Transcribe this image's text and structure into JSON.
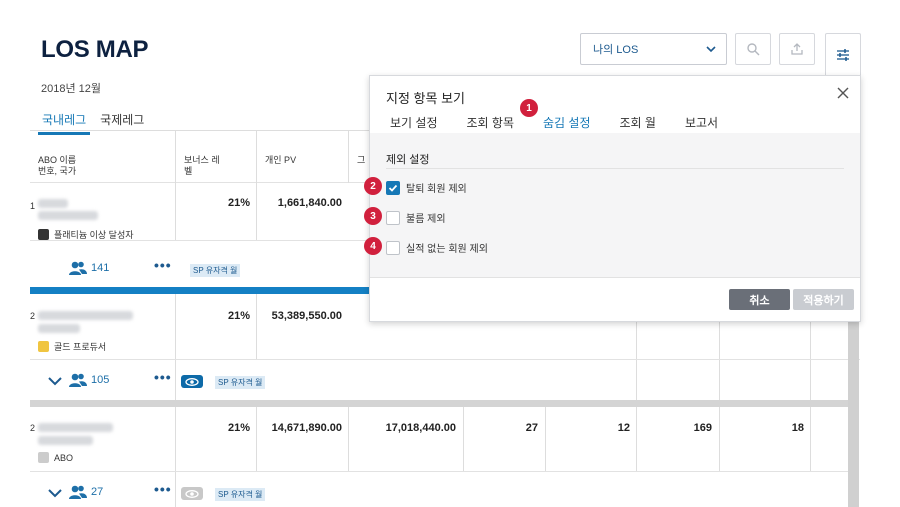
{
  "header": {
    "title": "LOS MAP",
    "period": "2018년 12월"
  },
  "toolbar": {
    "los_select_value": "나의 LOS",
    "icons": [
      "search-icon",
      "export-icon",
      "filter-settings-icon"
    ]
  },
  "main_tabs": [
    {
      "label": "국내레그",
      "active": true
    },
    {
      "label": "국제레그",
      "active": false
    }
  ],
  "table": {
    "headers": {
      "abo": "ABO 이름",
      "abo2": "번호, 국가",
      "bonus": "보너스 레",
      "bonus2": "벨",
      "pv": "개인 PV",
      "group": "그"
    },
    "rows": [
      {
        "index": "1",
        "bonus": "21%",
        "pv": "1,661,840.00",
        "legend": "플래티늄 이상 달성자",
        "legend_color": "#333333",
        "people_count": "141",
        "sp_tag": "SP 유자격 월"
      },
      {
        "index": "2",
        "bonus": "21%",
        "pv": "53,389,550.00",
        "legend": "골드 프로듀서",
        "legend_color": "#f0c541",
        "people_count": "105",
        "sp_tag": "SP 유자격 월"
      },
      {
        "index": "2",
        "bonus": "21%",
        "pv": "14,671,890.00",
        "group": "17,018,440.00",
        "c1": "27",
        "c2": "12",
        "c3": "169",
        "c4": "18",
        "legend": "ABO",
        "legend_color": "#cccccc",
        "people_count": "27",
        "sp_tag": "SP 유자격 월"
      }
    ]
  },
  "panel": {
    "title": "지정 항목 보기",
    "tabs": [
      {
        "label": "보기 설정"
      },
      {
        "label": "조회 항목"
      },
      {
        "label": "숨김 설정",
        "active": true
      },
      {
        "label": "조회 월"
      },
      {
        "label": "보고서"
      }
    ],
    "section_title": "제외 설정",
    "options": [
      {
        "label": "탈퇴 회원 제외",
        "checked": true
      },
      {
        "label": "불름 제외",
        "checked": false
      },
      {
        "label": "실적 없는 회원 제외",
        "checked": false
      }
    ],
    "cancel_label": "취소",
    "apply_label": "적용하기"
  },
  "badges": [
    "1",
    "2",
    "3",
    "4"
  ],
  "colors": {
    "accent": "#1678b6",
    "navy": "#0d2140",
    "badge": "#d1203d"
  }
}
